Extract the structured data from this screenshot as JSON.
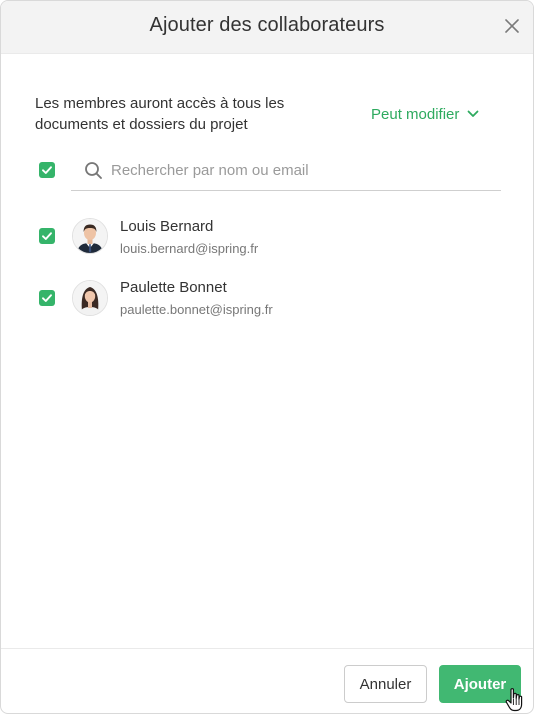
{
  "dialog": {
    "title": "Ajouter des collaborateurs",
    "close_icon": "close-icon"
  },
  "intro": {
    "text": "Les membres auront accès à tous les documents et dossiers du projet"
  },
  "permission": {
    "selected": "Peut modifier",
    "icon": "chevron-down-icon"
  },
  "select_all": {
    "checked": true
  },
  "search": {
    "placeholder": "Rechercher par nom ou email",
    "value": "",
    "icon": "search-icon"
  },
  "members": [
    {
      "name": "Louis Bernard",
      "email": "louis.bernard@ispring.fr",
      "checked": true
    },
    {
      "name": "Paulette Bonnet",
      "email": "paulette.bonnet@ispring.fr",
      "checked": true
    }
  ],
  "footer": {
    "cancel_label": "Annuler",
    "add_label": "Ajouter"
  },
  "colors": {
    "accent": "#35b46a",
    "primary_button": "#41b872",
    "link": "#2eaa5f",
    "header_bg": "#f3f3f3"
  }
}
